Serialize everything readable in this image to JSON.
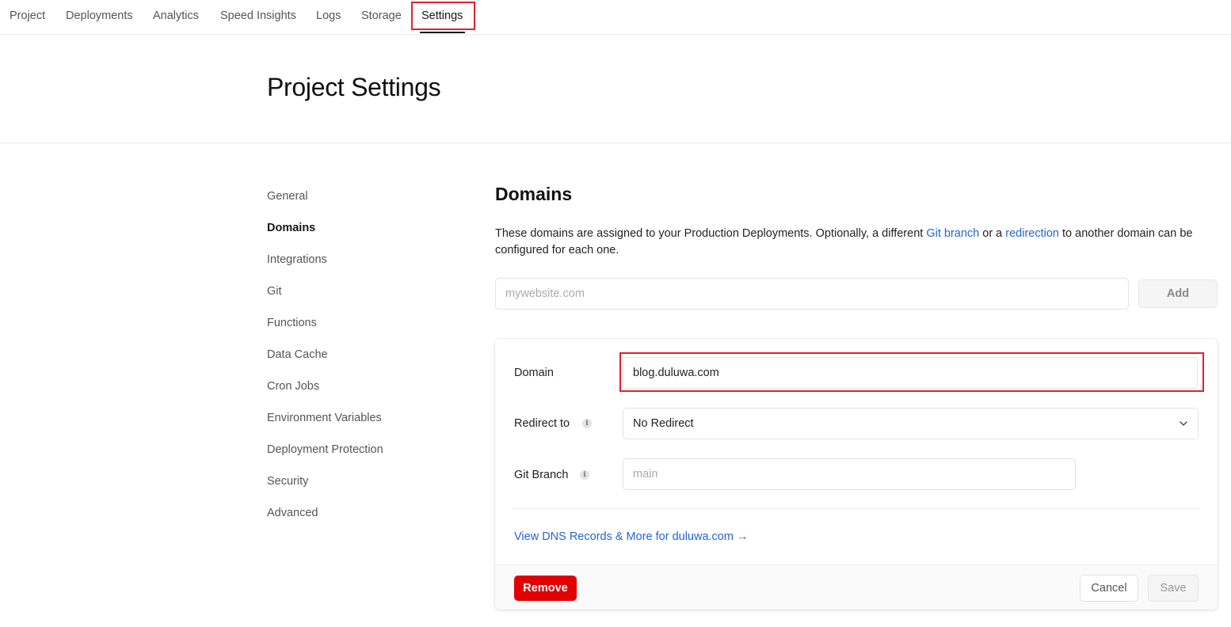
{
  "topnav": {
    "tabs": [
      {
        "label": "Project"
      },
      {
        "label": "Deployments"
      },
      {
        "label": "Analytics"
      },
      {
        "label": "Speed Insights"
      },
      {
        "label": "Logs"
      },
      {
        "label": "Storage"
      },
      {
        "label": "Settings",
        "active": true
      }
    ]
  },
  "header": {
    "title": "Project Settings"
  },
  "sidebar": {
    "items": [
      {
        "label": "General"
      },
      {
        "label": "Domains",
        "active": true
      },
      {
        "label": "Integrations"
      },
      {
        "label": "Git"
      },
      {
        "label": "Functions"
      },
      {
        "label": "Data Cache"
      },
      {
        "label": "Cron Jobs"
      },
      {
        "label": "Environment Variables"
      },
      {
        "label": "Deployment Protection"
      },
      {
        "label": "Security"
      },
      {
        "label": "Advanced"
      }
    ]
  },
  "domains": {
    "title": "Domains",
    "description": {
      "part1": "These domains are assigned to your Production Deployments. Optionally, a different ",
      "link1": "Git branch",
      "part2": " or a ",
      "link2": "redirection",
      "part3": " to another domain can be configured for each one."
    },
    "new_domain_placeholder": "mywebsite.com",
    "add_label": "Add"
  },
  "domain_card": {
    "domain_label": "Domain",
    "domain_value": "blog.duluwa.com",
    "redirect_label": "Redirect to",
    "redirect_value": "No Redirect",
    "git_branch_label": "Git Branch",
    "git_branch_placeholder": "main",
    "dns_link": "View DNS Records & More for duluwa.com →",
    "remove_label": "Remove",
    "cancel_label": "Cancel",
    "save_label": "Save"
  },
  "icons": {
    "info": "info-icon",
    "chevron": "chevron-down-icon"
  },
  "colors": {
    "link": "#2563d9",
    "danger": "#e00000",
    "highlight": "#e5202a"
  }
}
